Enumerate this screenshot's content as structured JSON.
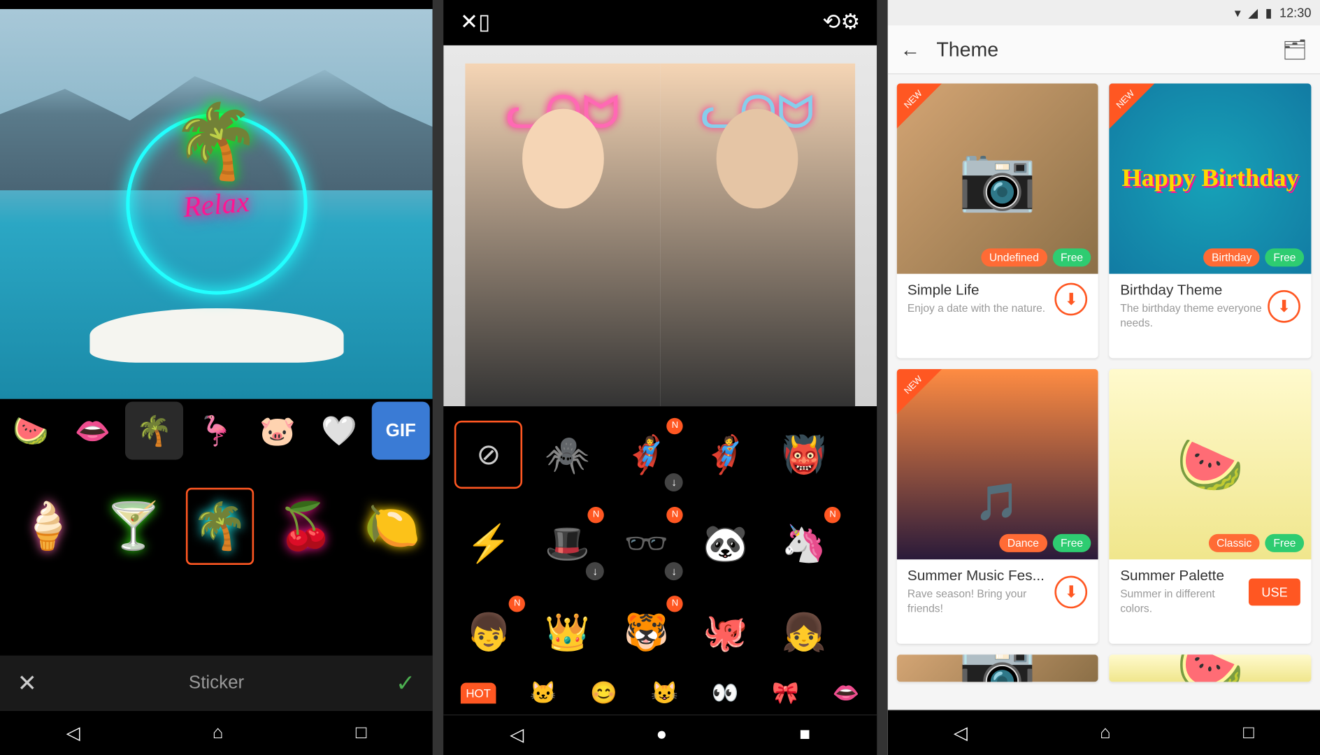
{
  "panel1": {
    "preview_overlay_text": "Relax",
    "categories": [
      {
        "emoji": "🍉",
        "sel": false
      },
      {
        "emoji": "👄",
        "sel": false
      },
      {
        "emoji": "🌴",
        "sel": true
      },
      {
        "emoji": "🦩",
        "sel": false
      },
      {
        "emoji": "🐷",
        "sel": false
      },
      {
        "emoji": "🤍",
        "sel": false
      }
    ],
    "gif_label": "GIF",
    "stickers": [
      {
        "glyph": "🍦",
        "color": "#ff69b4",
        "sel": false
      },
      {
        "glyph": "🍸",
        "color": "#39ff14",
        "sel": false
      },
      {
        "glyph": "🌴",
        "color": "#2ff",
        "sel": true
      },
      {
        "glyph": "🍒",
        "color": "#ff1493",
        "sel": false
      },
      {
        "glyph": "🍋",
        "color": "#ffd700",
        "sel": false
      }
    ],
    "footer_label": "Sticker"
  },
  "panel2": {
    "filter_rows": [
      [
        {
          "type": "none"
        },
        {
          "emoji": "🕷️",
          "badge": false,
          "dl": false
        },
        {
          "emoji": "🦸‍♀️",
          "badge": true,
          "dl": true
        },
        {
          "emoji": "🦸",
          "badge": false,
          "dl": false
        },
        {
          "emoji": "👹",
          "badge": false,
          "dl": false
        }
      ],
      [
        {
          "emoji": "⚡",
          "badge": false,
          "dl": false
        },
        {
          "emoji": "🎩",
          "badge": true,
          "dl": true
        },
        {
          "emoji": "🕶️",
          "badge": true,
          "dl": true
        },
        {
          "emoji": "🐼",
          "badge": false,
          "dl": false
        },
        {
          "emoji": "🦄",
          "badge": true,
          "dl": false
        }
      ],
      [
        {
          "emoji": "👦",
          "badge": true,
          "dl": false
        },
        {
          "emoji": "👑",
          "badge": false,
          "dl": false
        },
        {
          "emoji": "🐯",
          "badge": true,
          "dl": false
        },
        {
          "emoji": "🐙",
          "badge": false,
          "dl": false
        },
        {
          "emoji": "👧",
          "badge": false,
          "dl": false
        }
      ]
    ],
    "tabs": [
      {
        "label": "HOT",
        "type": "hot"
      },
      {
        "emoji": "🐱"
      },
      {
        "emoji": "😊"
      },
      {
        "emoji": "😺"
      },
      {
        "emoji": "👀"
      },
      {
        "emoji": "🎀"
      },
      {
        "emoji": "👄"
      }
    ]
  },
  "panel3": {
    "status_time": "12:30",
    "header_title": "Theme",
    "themes": [
      {
        "title": "Simple Life",
        "desc": "Enjoy a date with the nature.",
        "tag1": "Undefined",
        "tag2": "Free",
        "new": true,
        "action": "download",
        "imgClass": "t1"
      },
      {
        "title": "Birthday Theme",
        "desc": "The birthday theme everyone needs.",
        "tag1": "Birthday",
        "tag2": "Free",
        "new": true,
        "action": "download",
        "imgClass": "t2",
        "hb": "Happy Birthday"
      },
      {
        "title": "Summer Music Fes...",
        "desc": "Rave season! Bring your friends!",
        "tag1": "Dance",
        "tag2": "Free",
        "new": true,
        "action": "download",
        "imgClass": "t3"
      },
      {
        "title": "Summer Palette",
        "desc": "Summer in different colors.",
        "tag1": "Classic",
        "tag2": "Free",
        "new": false,
        "action": "use",
        "imgClass": "t4"
      }
    ],
    "use_label": "USE",
    "new_label": "NEW"
  }
}
